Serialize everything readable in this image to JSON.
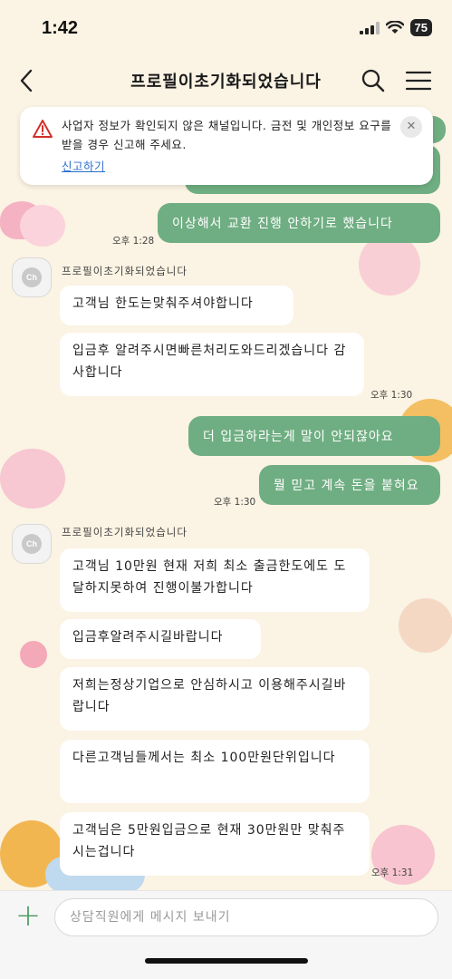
{
  "status_bar": {
    "time": "1:42",
    "battery": "75"
  },
  "header": {
    "title": "프로필이초기화되었습니다"
  },
  "notice": {
    "text": "사업자 정보가 확인되지 않은 채널입니다. 금전 및 개인정보 요구를 받을 경우 신고해 주세요.",
    "link": "신고하기",
    "close": "✕"
  },
  "messages": {
    "m1": {
      "text": "이상해서 교환 진행 안하기로 했습니다",
      "time": "오후 1:28"
    },
    "sender1": "프로필이초기화되었습니다",
    "m2": {
      "text": "고객님 한도는맞춰주셔야합니다"
    },
    "m3": {
      "text": "입금후 알려주시면빠른처리도와드리겠습니다 감사합니다",
      "time": "오후 1:30"
    },
    "m4": {
      "text": "더 입금하라는게 말이 안되잖아요"
    },
    "m5": {
      "text": "뭘 믿고 계속 돈을 붙혀요",
      "time": "오후 1:30"
    },
    "sender2": "프로필이초기화되었습니다",
    "m6": {
      "text": "고객님 10만원 현재 저희 최소 출금한도에도 도달하지못하여 진행이불가합니다"
    },
    "m7": {
      "text": "입금후알려주시길바랍니다"
    },
    "m8": {
      "text": "저희는정상기업으로 안심하시고 이용해주시길바랍니다"
    },
    "m9": {
      "text": "다른고객님들께서는 최소 100만원단위입니다"
    },
    "m10": {
      "text": "고객님은 5만원입금으로 현재 30만원만 맞춰주시는겁니다",
      "time": "오후 1:31"
    }
  },
  "input": {
    "placeholder": "상담직원에게 메시지 보내기",
    "plus": "+"
  },
  "colors": {
    "out_bubble": "#6fae82",
    "background": "#fbf3e3",
    "link": "#2a6fc9"
  },
  "icons": [
    "back-arrow-icon",
    "search-icon",
    "menu-icon",
    "warning-icon",
    "close-icon",
    "plus-icon",
    "profile-avatar-icon"
  ]
}
